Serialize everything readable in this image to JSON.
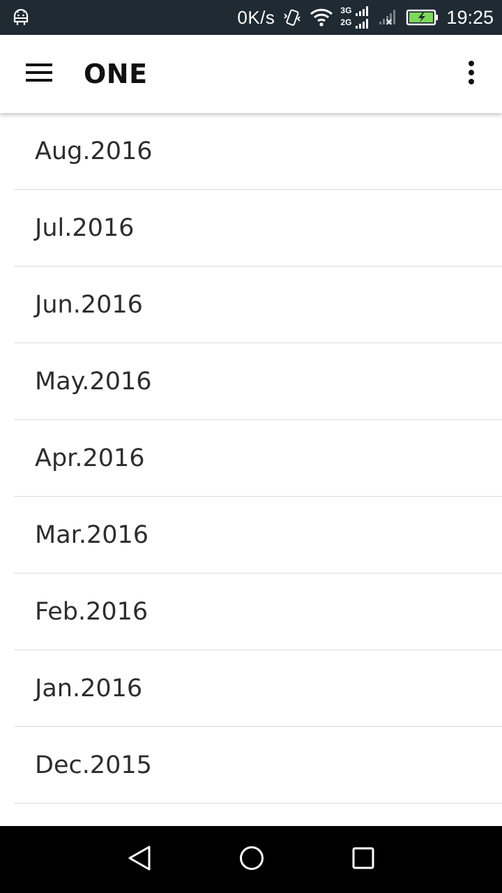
{
  "status_bar": {
    "network_speed": "0K/s",
    "signal_3g": "3G",
    "signal_2g": "2G",
    "time": "19:25",
    "icons": [
      "android-debug-icon",
      "vibrate-icon",
      "wifi-icon",
      "cell-signal-icon",
      "no-signal-icon",
      "battery-charging-icon"
    ],
    "battery_color": "#7dd85a"
  },
  "app_bar": {
    "title": "ONE",
    "menu_icon": "hamburger-menu-icon",
    "overflow_icon": "more-vert-icon"
  },
  "months": [
    {
      "label": "Aug.2016"
    },
    {
      "label": "Jul.2016"
    },
    {
      "label": "Jun.2016"
    },
    {
      "label": "May.2016"
    },
    {
      "label": "Apr.2016"
    },
    {
      "label": "Mar.2016"
    },
    {
      "label": "Feb.2016"
    },
    {
      "label": "Jan.2016"
    },
    {
      "label": "Dec.2015"
    }
  ],
  "nav_bar": {
    "icons": [
      "back-icon",
      "home-icon",
      "recents-icon"
    ]
  }
}
